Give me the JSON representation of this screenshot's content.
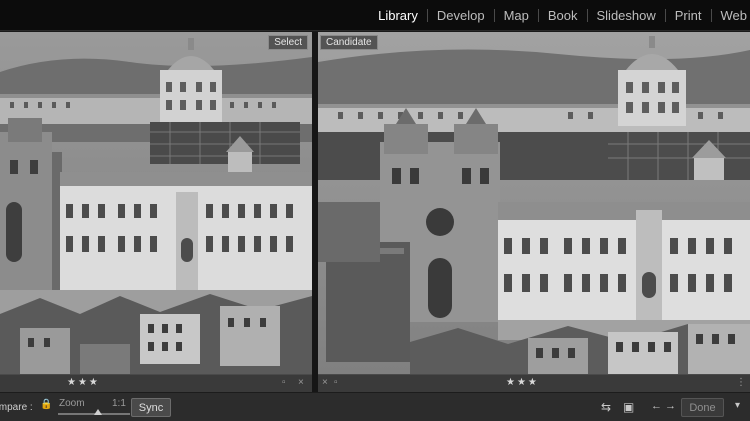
{
  "modules": [
    {
      "label": "Library",
      "active": true
    },
    {
      "label": "Develop",
      "active": false
    },
    {
      "label": "Map",
      "active": false
    },
    {
      "label": "Book",
      "active": false
    },
    {
      "label": "Slideshow",
      "active": false
    },
    {
      "label": "Print",
      "active": false
    },
    {
      "label": "Web",
      "active": false
    }
  ],
  "panes": {
    "select_label": "Select",
    "candidate_label": "Candidate",
    "select_rating": "★★★",
    "candidate_rating": "★★★",
    "strip_x": "×"
  },
  "toolbar": {
    "compare_label": "Compare :",
    "zoom_label": "Zoom",
    "zoom_value": "1:1",
    "sync_label": "Sync",
    "done_label": "Done",
    "arrows": "← →",
    "swap_icon": "⇆",
    "menu_icon": "▾",
    "lock_icon": "🔒"
  },
  "colors": {
    "topbar": "#0c0c0c",
    "panel": "#2c2c2c",
    "strip": "#3a3a3a",
    "active_module": "#ffffff"
  }
}
